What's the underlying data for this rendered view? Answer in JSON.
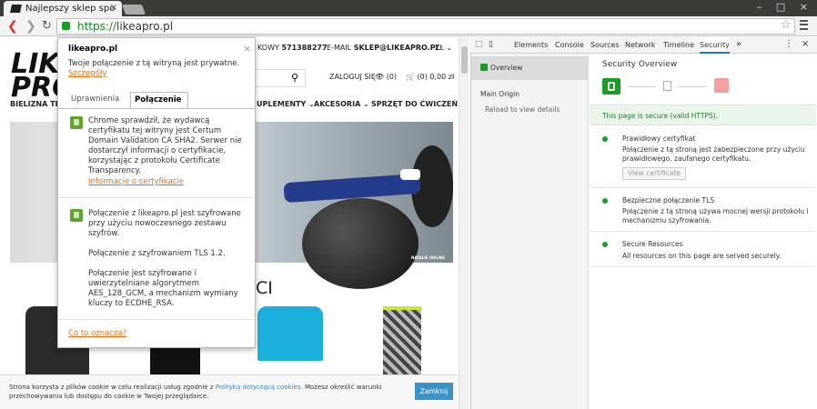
{
  "browser": {
    "tab_title": "Najlepszy sklep spo",
    "url_scheme": "https://",
    "url_host": "likeapro.pl"
  },
  "site": {
    "logo_line1": "LIKE A",
    "logo_line2": "PRO",
    "logo_sub": "BIELIZNA TER",
    "phone_label": "KOWY",
    "phone": "571388277",
    "email_label": "E-MAIL",
    "email": "SKLEP@LIKEAPRO.PL",
    "currency": "ZŁ",
    "login": "ZALOGUJ SIĘ",
    "wishlist_count": "(0)",
    "cart": "(0) 0,00 zł",
    "nav": [
      "UPLEMENTY",
      "AKCESORIA",
      "SPRZĘT DO ĆWICZEŃ"
    ],
    "hero_caption": "NATALIE UHLING",
    "section_heading": "CI"
  },
  "security_popup": {
    "domain": "likeapro.pl",
    "private_msg": "Twoje połączenie z tą witryną jest prywatne.",
    "details_link": "Szczegóły",
    "tabs": [
      "Uprawnienia",
      "Połączenie"
    ],
    "cert_text": "Chrome sprawdził, że wydawcą certyfikatu tej witryny jest Certum Domain Validation CA SHA2. Serwer nie dostarczył informacji o certyfikacie, korzystając z protokołu Certificate Transparency.",
    "cert_link": "Informacje o certyfikacie",
    "enc_text_1": "Połączenie z likeapro.pl jest szyfrowane przy użyciu nowoczesnego zestawu szyfrów.",
    "enc_text_2": "Połączenie z szyfrowaniem TLS 1.2.",
    "enc_text_3": "Połączenie jest szyfrowane i uwierzytelniane algorytmem AES_128_GCM, a mechanizm wymiany kluczy to ECDHE_RSA.",
    "what_link": "Co to oznacza?",
    "close": "×"
  },
  "cookie": {
    "text_a": "Strona korzysta z plików cookie w celu realizacji usług zgodnie z",
    "link": "Polityką dotyczącą cookies.",
    "text_b": "Możesz określić warunki przechowywania lub dostępu do cookie w Twojej przeglądarce.",
    "button": "Zamknij"
  },
  "devtools": {
    "tabs": [
      "Elements",
      "Console",
      "Sources",
      "Network",
      "Timeline",
      "Security"
    ],
    "more": "»",
    "sidebar": {
      "overview": "Overview",
      "main_origin": "Main Origin",
      "reload": "Reload to view details"
    },
    "title": "Security Overview",
    "secure_banner": "This page is secure (valid HTTPS).",
    "items": [
      {
        "title": "Prawidłowy certyfikat",
        "desc": "Połączenie z tą stroną jest zabezpieczone przy użyciu prawidłowego, zaufanego certyfikatu."
      },
      {
        "title": "Bezpieczne połączenie TLS",
        "desc": "Połączenie z tą stroną używa mocnej wersji protokołu i mechanizmu szyfrowania."
      },
      {
        "title": "Secure Resources",
        "desc": "All resources on this page are served securely."
      }
    ],
    "view_cert": "View certificate"
  },
  "colors": {
    "secure_green": "#1a9c27",
    "link_orange": "#e0701c",
    "devtools_blue": "#1a73e8"
  }
}
